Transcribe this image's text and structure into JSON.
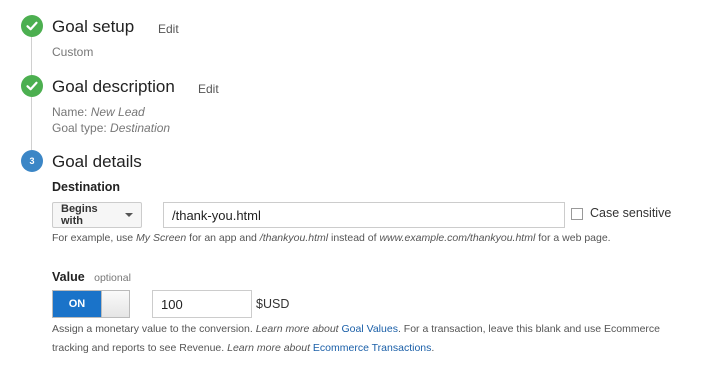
{
  "steps": [
    {
      "title": "Goal setup",
      "edit_label": "Edit",
      "summary": "Custom"
    },
    {
      "title": "Goal description",
      "edit_label": "Edit",
      "name_label": "Name:",
      "name_value": "New Lead",
      "type_label": "Goal type:",
      "type_value": "Destination"
    },
    {
      "number": "3",
      "title": "Goal details"
    }
  ],
  "destination": {
    "label": "Destination",
    "match_type": "Begins with",
    "value": "/thank-you.html",
    "case_sensitive_label": "Case sensitive",
    "help": {
      "p1": "For example, use ",
      "i1": "My Screen",
      "p2": " for an app and ",
      "i2": "/thankyou.html",
      "p3": " instead of ",
      "i3": "www.example.com/thankyou.html",
      "p4": " for a web page."
    }
  },
  "value": {
    "label": "Value",
    "optional_label": "optional",
    "toggle_label": "ON",
    "amount": "100",
    "currency": "$USD",
    "help": {
      "p1": "Assign a monetary value to the conversion. ",
      "i1": "Learn more about ",
      "link1": "Goal Values",
      "p2": ". For a transaction, leave this blank and use Ecommerce",
      "p3": "tracking and reports to see Revenue. ",
      "i2": "Learn more about ",
      "link2": "Ecommerce Transactions",
      "p4": "."
    }
  },
  "colors": {
    "done": "#4caf50",
    "active": "#3b86c6",
    "toggle_on": "#1a73c9",
    "link": "#1a5fa8"
  }
}
